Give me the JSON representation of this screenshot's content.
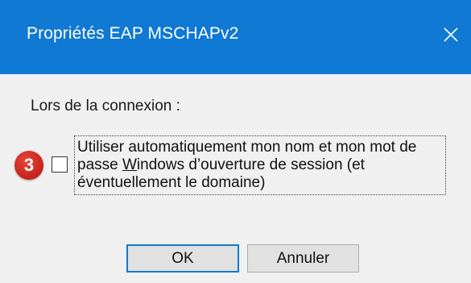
{
  "window": {
    "title": "Propriétés EAP MSCHAPv2",
    "close_icon": "close-icon"
  },
  "group": {
    "label": "Lors de la connexion :"
  },
  "step_badge": {
    "number": "3",
    "color": "#d32a22"
  },
  "checkbox": {
    "checked": false,
    "label_lines": {
      "line1": "Utiliser automatiquement mon nom et mon mot de",
      "line2_pre": "passe ",
      "line2_accel": "W",
      "line2_post": "indows d’ouverture de session (et",
      "line3": "éventuellement le domaine)"
    }
  },
  "buttons": {
    "ok_label": "OK",
    "cancel_label": "Annuler"
  },
  "colors": {
    "titlebar": "#0f79d3",
    "background": "#f0f0f0",
    "button_focus_border": "#0f79d3"
  }
}
